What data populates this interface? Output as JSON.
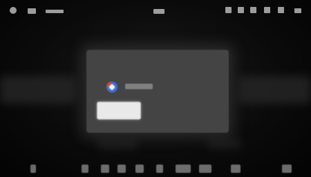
{
  "dialog": {
    "title": "",
    "primary_label": "",
    "second_label": "",
    "third_label": ""
  },
  "account": {
    "icon": "google-account-icon"
  },
  "status_bar": {
    "icons": [
      "settings-icon",
      "signal-icon",
      "clock-text",
      "wifi-icon",
      "battery-icon",
      "notification-icon",
      "bluetooth-icon",
      "sound-icon"
    ]
  },
  "bottom_bar": {
    "icons": [
      "back-icon",
      "home-icon",
      "apps-icon",
      "media-icon",
      "navigation-icon",
      "phone-icon",
      "music-icon",
      "voice-icon",
      "menu-icon"
    ]
  },
  "colors": {
    "dialog_bg": "#444444",
    "primary_button_bg": "#e9e9e9",
    "accent_blue": "#3b6fd8",
    "accent_red": "#d24a3a"
  }
}
